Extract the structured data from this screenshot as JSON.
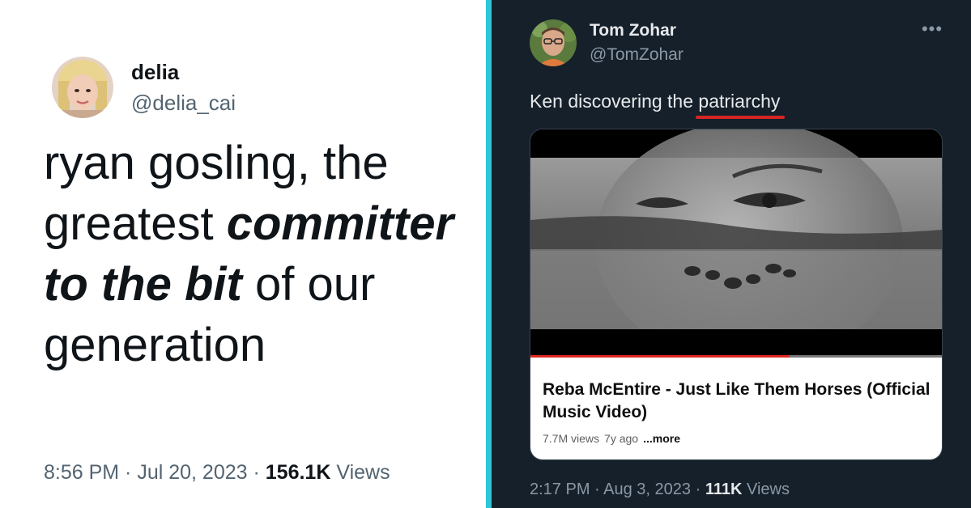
{
  "left_tweet": {
    "display_name": "delia",
    "handle": "@delia_cai",
    "body": {
      "part1": "ryan gosling, the greatest ",
      "emphasis": "committer to the bit",
      "part2": " of our generation"
    },
    "time": "8:56 PM",
    "date": "Jul 20, 2023",
    "views_count": "156.1K",
    "views_label": "Views",
    "separator": " · "
  },
  "right_tweet": {
    "display_name": "Tom Zohar",
    "handle": "@TomZohar",
    "more_icon": "•••",
    "text_before": "Ken discovering the ",
    "text_underlined": "patriarchy",
    "card": {
      "title": "Reba McEntire - Just Like Them Horses (Official Music Video)",
      "views": "7.7M views",
      "age": "7y ago",
      "more": "...more",
      "progress": 0.63
    },
    "time": "2:17 PM",
    "date": "Aug 3, 2023",
    "views_count": "111K",
    "views_label": "Views",
    "separator": " · "
  },
  "colors": {
    "divider": "#2ec6d8",
    "dark_bg": "#15202b",
    "underline_red": "#d62424",
    "progress_red": "#e0281f"
  }
}
